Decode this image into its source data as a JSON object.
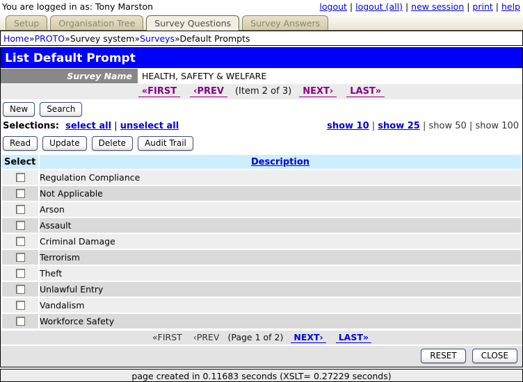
{
  "colors": {
    "title_bg": "#0000ff",
    "title_text": "#ffffff",
    "link_blue": "#0000dd",
    "visited_link_purple": "#880088",
    "table_header_bg": "#cceeff",
    "row_light": "#eeeeee",
    "row_dark": "#dadada",
    "survey_label_bg": "#888888",
    "tab_inactive_bg": "#d2c9a8",
    "tab_active_bg": "#f2efe2"
  },
  "top_bar": {
    "logged_in_text": "You are logged in as: Tony Marston",
    "separator": "|",
    "links": [
      "logout",
      "logout (all)",
      "new session",
      "print",
      "help"
    ]
  },
  "tabs": [
    {
      "label": "Setup",
      "active": false
    },
    {
      "label": "Organisation Tree",
      "active": false
    },
    {
      "label": "Survey Questions",
      "active": true
    },
    {
      "label": "Survey Answers",
      "active": false
    }
  ],
  "breadcrumb": {
    "separator": "»",
    "items": [
      {
        "label": "Home",
        "link": true
      },
      {
        "label": "PROTO",
        "link": true
      },
      {
        "label": "Survey system",
        "link": false
      },
      {
        "label": "Surveys",
        "link": true
      },
      {
        "label": "Default Prompts",
        "link": false
      }
    ]
  },
  "page_title": "List Default Prompt",
  "survey": {
    "label": "Survey Name",
    "value": "HEALTH, SAFETY & WELFARE"
  },
  "item_nav": {
    "first": "«FIRST",
    "prev": "‹PREV",
    "position": "(Item 2 of 3)",
    "next": "NEXT›",
    "last": "LAST»"
  },
  "toolbar_top": {
    "buttons": [
      "New",
      "Search"
    ]
  },
  "selections": {
    "label": "Selections:",
    "separator": "|",
    "select_all": "select all",
    "unselect_all": "unselect all"
  },
  "show_options": [
    {
      "label": "show 10",
      "link": true
    },
    {
      "label": "show 25",
      "link": true
    },
    {
      "label": "show 50",
      "link": false
    },
    {
      "label": "show 100",
      "link": false
    }
  ],
  "toolbar_actions": {
    "buttons": [
      "Read",
      "Update",
      "Delete",
      "Audit Trail"
    ]
  },
  "table": {
    "columns": {
      "select": "Select",
      "description": "Description"
    },
    "rows": [
      "Regulation Compliance",
      "Not Applicable",
      "Arson",
      "Assault",
      "Criminal Damage",
      "Terrorism",
      "Theft",
      "Unlawful Entry",
      "Vandalism",
      "Workforce Safety"
    ]
  },
  "page_nav": {
    "first": "«FIRST",
    "prev": "‹PREV",
    "position": "(Page 1 of 2)",
    "next": "NEXT›",
    "last": "LAST»"
  },
  "footer_buttons": [
    "RESET",
    "CLOSE"
  ],
  "footer_text": "page created in 0.11683 seconds (XSLT= 0.27229 seconds)"
}
